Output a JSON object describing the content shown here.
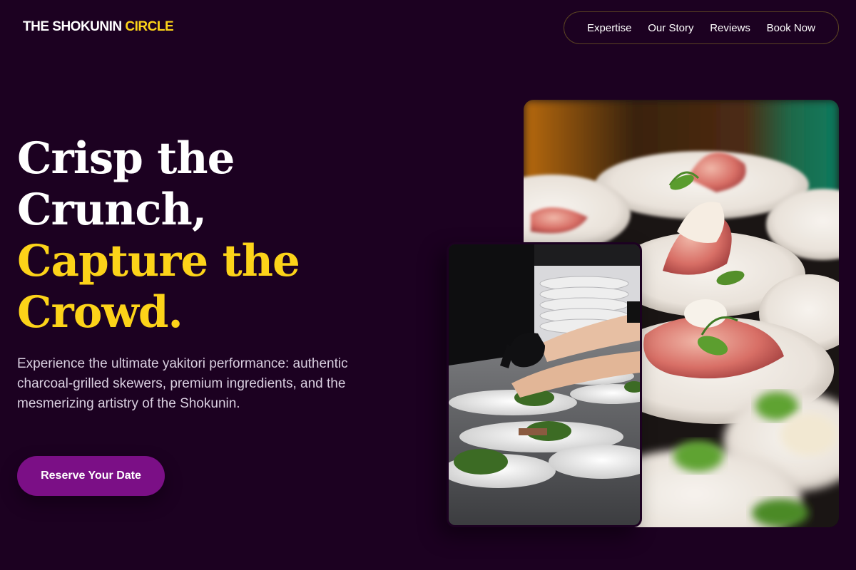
{
  "brand": {
    "part1": "THE SHOKUNIN ",
    "part2": "CIRCLE"
  },
  "nav": {
    "items": [
      "Expertise",
      "Our Story",
      "Reviews",
      "Book Now"
    ]
  },
  "hero": {
    "line1": "Crisp the",
    "line2": "Crunch,",
    "line3": "Capture the",
    "line4": "Crowd.",
    "description": "Experience the ultimate yakitori performance: authentic charcoal-grilled skewers, premium ingredients, and the mesmerizing artistry of the Shokunin.",
    "cta_label": "Reserve Your Date"
  },
  "images": {
    "main": "plated-appetizers-photo",
    "side": "chef-plating-photo"
  },
  "colors": {
    "background": "#1c0121",
    "accent_gold": "#fcd319",
    "button_purple": "#7b0f86"
  }
}
